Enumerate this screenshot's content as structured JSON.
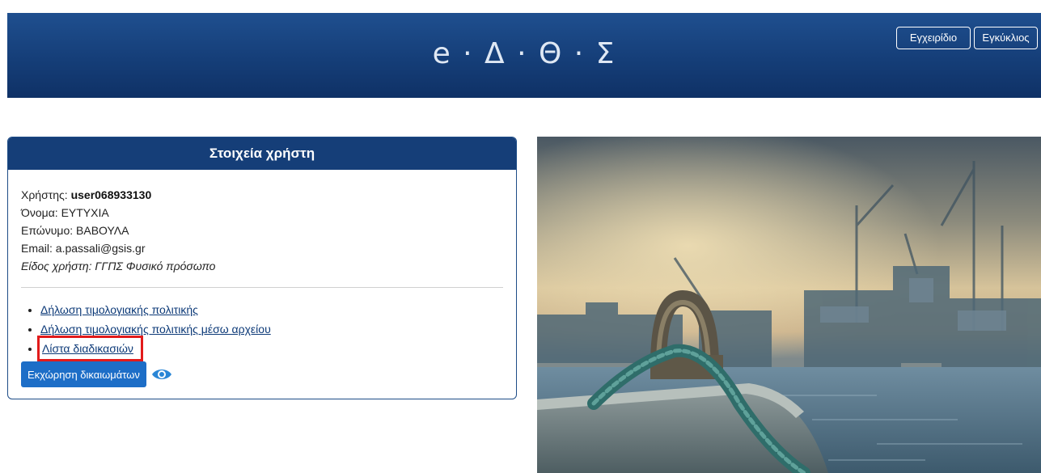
{
  "header": {
    "logo_text": "e · Δ · Θ · Σ",
    "buttons": {
      "manual": "Εγχειρίδιο",
      "circular": "Εγκύκλιος"
    }
  },
  "user_card": {
    "title": "Στοιχεία χρήστη",
    "user_label": "Χρήστης: ",
    "user_value": "user068933130",
    "name": "Όνομα: ΕΥΤΥΧΙΑ",
    "surname": "Επώνυμο: ΒΑΒΟΥΛΑ",
    "email": "Email: a.passali@gsis.gr",
    "user_type": "Είδος χρήστη: ΓΓΠΣ Φυσικό πρόσωπο",
    "links": [
      "Δήλωση τιμολογιακής πολιτικής",
      "Δήλωση τιμολογιακής πολιτικής μέσω αρχείου",
      "Λίστα διαδικασιών"
    ],
    "assign_button": "Εκχώρηση δικαιωμάτων",
    "eye_icon": "eye-icon"
  },
  "colors": {
    "banner": "#153e78",
    "primary_button": "#1d6ec7",
    "highlight": "#e21b1b"
  }
}
